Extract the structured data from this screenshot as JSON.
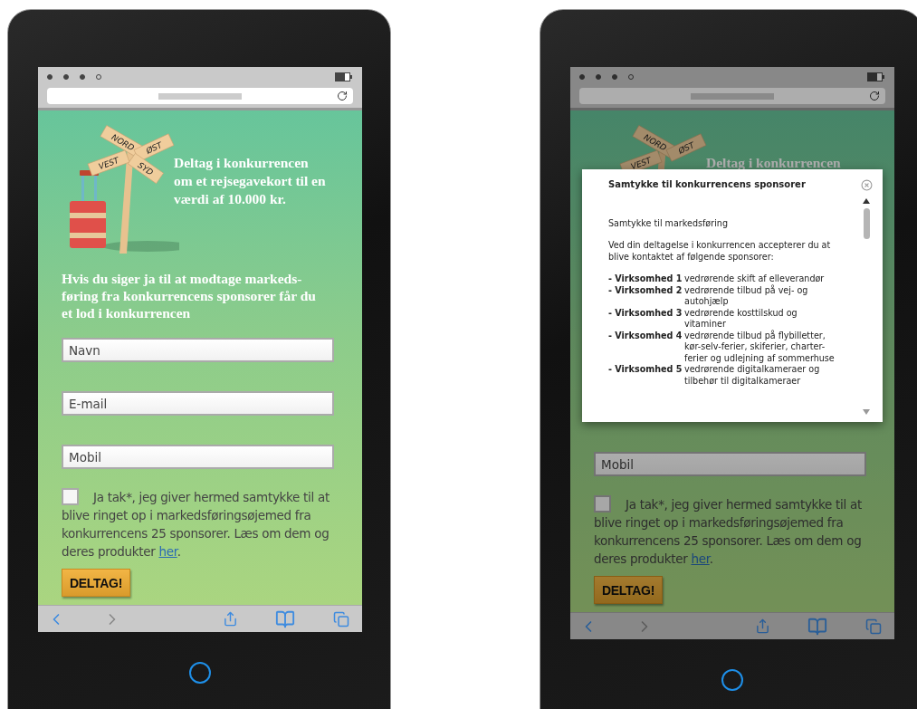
{
  "phones": [
    {
      "dimmed": false,
      "sign_labels": [
        "NORD",
        "ØST",
        "VEST",
        "SYD"
      ],
      "headline": "Deltag i konkurrencen om et rejsegavekort til en værdi af 10.000 kr.",
      "intro": "Hvis du siger ja til at modtage markeds-føring fra konkurrencens sponsorer får du et lod i konkurrencen",
      "fields": [
        {
          "placeholder": "Navn"
        },
        {
          "placeholder": "E-mail"
        },
        {
          "placeholder": "Mobil"
        }
      ],
      "consent": {
        "checked": false,
        "text": "Ja tak*, jeg giver hermed samtykke til at blive ringet op i markedsføringsøjemed fra konkurrencens 25 sponsorer. Læs om dem og deres produkter",
        "link": "her",
        "after": "."
      },
      "button": "DELTAG!"
    },
    {
      "dimmed": true,
      "sign_labels": [
        "NORD",
        "ØST",
        "VEST"
      ],
      "headline": "Deltag i konkurrencen",
      "fields": [
        {
          "placeholder": "Mobil"
        }
      ],
      "consent": {
        "checked": false,
        "text": "Ja tak*, jeg giver hermed samtykke til at blive ringet op i markedsføringsøjemed fra konkurrencens 25 sponsorer. Læs om dem og deres produkter",
        "link": "her",
        "after": "."
      },
      "button": "DELTAG!",
      "modal": {
        "title": "Samtykke til konkurrencens sponsorer",
        "paragraphs": [
          "Samtykke til markedsføring",
          "Ved din deltagelse i konkurrencen accepterer du at blive kontaktet af følgende sponsorer:"
        ],
        "sponsors": [
          {
            "name": "- Virksomhed 1",
            "text": "vedrørende skift af elleverandør"
          },
          {
            "name": "- Virksomhed 2",
            "text": "vedrørende tilbud på vej- og autohjælp"
          },
          {
            "name": "- Virksomhed 3",
            "text": "vedrørende kosttilskud og vitaminer"
          },
          {
            "name": "- Virksomhed 4",
            "text": "vedrørende tilbud på flybilletter, kør-selv-ferier, skiferier, charter-ferier og udlejning af sommerhuse"
          },
          {
            "name": "- Virksomhed 5",
            "text": "vedrørende digitalkameraer og tilbehør til digitalkameraer"
          }
        ]
      }
    }
  ]
}
